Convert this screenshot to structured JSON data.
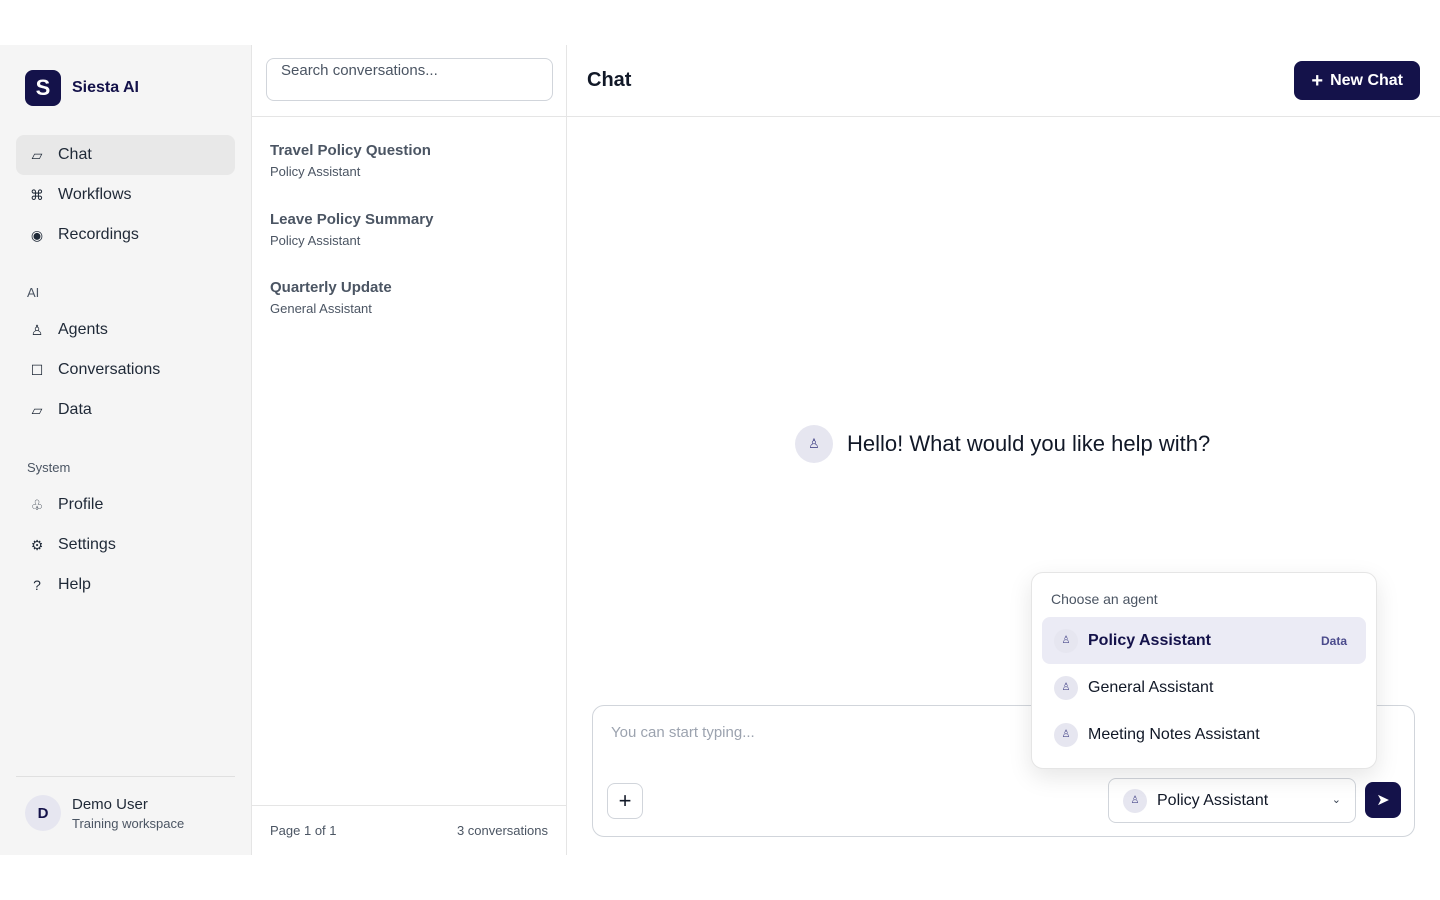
{
  "brand": {
    "logo_letter": "S",
    "name": "Siesta AI"
  },
  "nav": {
    "primary": [
      {
        "icon": "message-icon",
        "glyph": "▱",
        "label": "Chat",
        "active": true
      },
      {
        "icon": "command-icon",
        "glyph": "⌘",
        "label": "Workflows"
      },
      {
        "icon": "record-icon",
        "glyph": "◉",
        "label": "Recordings"
      }
    ],
    "ai_section": "AI",
    "ai": [
      {
        "icon": "agent-icon",
        "glyph": "♙",
        "label": "Agents"
      },
      {
        "icon": "square-icon",
        "glyph": "☐",
        "label": "Conversations"
      },
      {
        "icon": "data-icon",
        "glyph": "▱",
        "label": "Data"
      }
    ],
    "system_section": "System",
    "system": [
      {
        "icon": "profile-icon",
        "glyph": "♧",
        "label": "Profile"
      },
      {
        "icon": "gear-icon",
        "glyph": "⚙",
        "label": "Settings"
      },
      {
        "icon": "help-icon",
        "glyph": "?",
        "label": "Help"
      }
    ]
  },
  "user": {
    "initial": "D",
    "name": "Demo User",
    "workspace": "Training workspace"
  },
  "conversations": {
    "search_placeholder": "Search conversations...",
    "items": [
      {
        "title": "Travel Policy Question",
        "agent": "Policy Assistant"
      },
      {
        "title": "Leave Policy Summary",
        "agent": "Policy Assistant"
      },
      {
        "title": "Quarterly Update",
        "agent": "General Assistant"
      }
    ],
    "page": "Page 1 of 1",
    "count": "3 conversations"
  },
  "main": {
    "title": "Chat",
    "new_chat_label": "New Chat",
    "greeting": "Hello! What would you like help with?",
    "composer_placeholder": "You can start typing...",
    "selected_agent": "Policy Assistant"
  },
  "agent_dropdown": {
    "heading": "Choose an agent",
    "items": [
      {
        "label": "Policy Assistant",
        "badge": "Data",
        "selected": true
      },
      {
        "label": "General Assistant"
      },
      {
        "label": "Meeting Notes Assistant"
      }
    ]
  },
  "colors": {
    "brand": "#14124a",
    "accent_soft": "#e6e6f0"
  }
}
